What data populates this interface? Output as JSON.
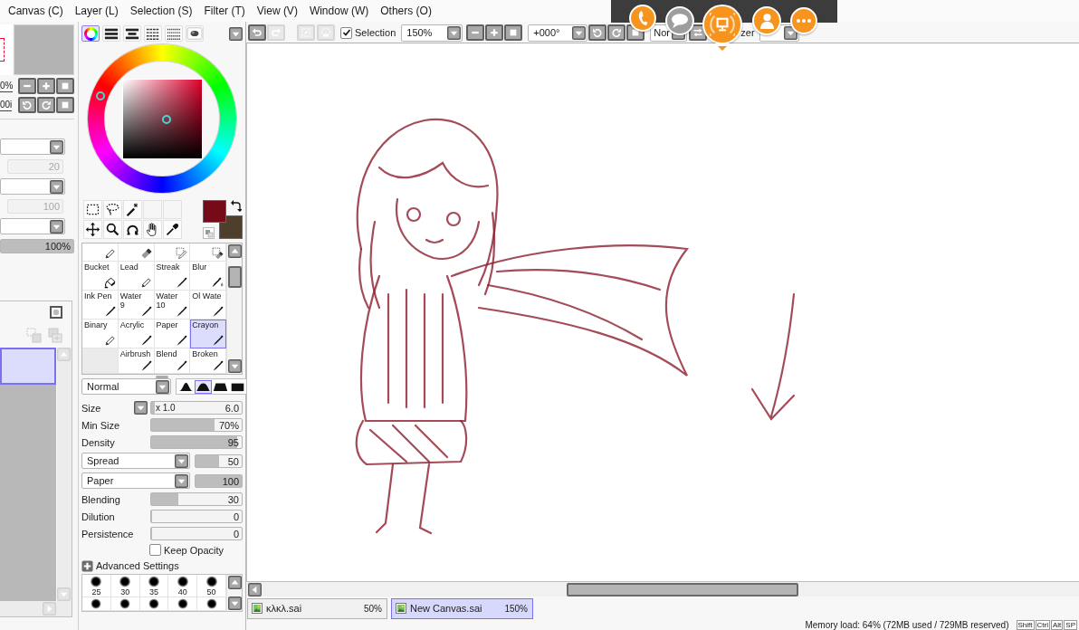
{
  "menu_bar": {
    "items": [
      "Canvas (C)",
      "Layer (L)",
      "Selection (S)",
      "Filter (T)",
      "View (V)",
      "Window (W)",
      "Others (O)"
    ]
  },
  "navigator": {
    "zoom_reading": "0%",
    "angle_reading": "00i",
    "zoom_buttons": [
      {
        "kind": "zoom-out"
      },
      {
        "kind": "zoom-in"
      },
      {
        "kind": "zoom-reset"
      }
    ],
    "rotate_buttons": [
      {
        "kind": "rotate-left"
      },
      {
        "kind": "rotate-right"
      },
      {
        "kind": "rotate-reset"
      }
    ]
  },
  "layer_properties": [
    {
      "kind": "dropdown",
      "disabled": false
    },
    {
      "kind": "slider",
      "reading": "20",
      "disabled": true
    },
    {
      "kind": "dropdown",
      "disabled": false
    },
    {
      "kind": "slider",
      "reading": "100",
      "disabled": true
    },
    {
      "kind": "dropdown",
      "disabled": false
    },
    {
      "kind": "slider",
      "reading": "100%",
      "level": 1,
      "disabled": false
    }
  ],
  "layer_panel": {
    "layers": [
      {
        "selected": true
      }
    ]
  },
  "color_panel": {
    "modes": [
      {
        "kind": "wheel",
        "selected": true
      },
      {
        "kind": "rgb",
        "selected": false
      },
      {
        "kind": "hsv",
        "selected": false
      },
      {
        "kind": "swatches",
        "selected": false
      },
      {
        "kind": "grid",
        "selected": false
      },
      {
        "kind": "scratchpad",
        "selected": false
      }
    ],
    "colors": [
      {
        "kind": "primary",
        "color": "#770a19"
      },
      {
        "kind": "secondary",
        "color": "#4e3f2d"
      }
    ]
  },
  "tools": [
    {
      "kind": "rect-select"
    },
    {
      "kind": "lasso"
    },
    {
      "kind": "magic-wand"
    },
    {
      "kind": "empty"
    },
    {
      "kind": "empty"
    },
    {
      "kind": "move"
    },
    {
      "kind": "zoom"
    },
    {
      "kind": "rotate"
    },
    {
      "kind": "hand"
    },
    {
      "kind": "eyedropper"
    }
  ],
  "brushes": [
    {
      "kind": "pencil",
      "selected": false
    },
    {
      "kind": "eraser",
      "selected": false
    },
    {
      "kind": "select-pen",
      "selected": false
    },
    {
      "kind": "select-eraser",
      "selected": false
    },
    {
      "label": "Bucket",
      "kind": "bucket",
      "selected": false
    },
    {
      "label": "Lead",
      "kind": "pencil",
      "selected": false
    },
    {
      "label": "Streak",
      "kind": "pen",
      "selected": false
    },
    {
      "label": "Blur",
      "kind": "blur",
      "selected": false
    },
    {
      "label": "Ink Pen",
      "kind": "pen",
      "selected": false
    },
    {
      "label": "Water\n9",
      "kind": "pen",
      "selected": false
    },
    {
      "label": "Water\n10",
      "kind": "pen",
      "selected": false
    },
    {
      "label": "Ol Wate",
      "kind": "pen",
      "selected": false
    },
    {
      "label": "Binary",
      "kind": "pencil",
      "selected": false
    },
    {
      "label": "Acrylic",
      "kind": "pen",
      "selected": false
    },
    {
      "label": "Paper",
      "kind": "pen",
      "selected": false
    },
    {
      "label": "Crayon",
      "kind": "pen",
      "selected": true
    },
    {
      "kind": "empty",
      "selected": false
    },
    {
      "label": "Airbrush",
      "kind": "pen",
      "selected": false
    },
    {
      "label": "Blend",
      "kind": "pen",
      "selected": false
    },
    {
      "label": "Broken",
      "kind": "pen",
      "selected": false
    }
  ],
  "brush_settings": {
    "blend_mode": "Normal",
    "shapes": [
      {
        "kind": "peak",
        "selected": false
      },
      {
        "kind": "mound",
        "selected": true
      },
      {
        "kind": "flat",
        "selected": false
      },
      {
        "kind": "block",
        "selected": false
      }
    ],
    "rows": [
      {
        "kind": "slider",
        "label": "Size",
        "menu": true,
        "scale": "x 1.0",
        "reading": "6.0",
        "level": 0.04
      },
      {
        "kind": "slider",
        "label": "Min Size",
        "menu": false,
        "reading": "70%",
        "level": 0.7
      },
      {
        "kind": "slider",
        "label": "Density",
        "menu": false,
        "reading": "95",
        "level": 0.95
      },
      {
        "kind": "select",
        "value": "Spread",
        "reading": "50",
        "level": 0.5
      },
      {
        "kind": "select",
        "value": "Paper",
        "reading": "100",
        "level": 1
      },
      {
        "kind": "slider",
        "label": "Blending",
        "menu": false,
        "reading": "30",
        "level": 0.3
      },
      {
        "kind": "slider",
        "label": "Dilution",
        "menu": false,
        "reading": "0",
        "level": 0
      },
      {
        "kind": "slider",
        "label": "Persistence",
        "menu": false,
        "reading": "0",
        "level": 0
      },
      {
        "kind": "checkbox",
        "label": "Keep Opacity",
        "checked": false
      },
      {
        "kind": "expander",
        "label": "Advanced Settings",
        "expanded": false
      }
    ]
  },
  "brush_sizes": [
    {
      "kind": "labeled",
      "label": "25"
    },
    {
      "kind": "labeled",
      "label": "30"
    },
    {
      "kind": "labeled",
      "label": "35"
    },
    {
      "kind": "labeled",
      "label": "40"
    },
    {
      "kind": "labeled",
      "label": "50"
    },
    {
      "kind": "unlabeled"
    },
    {
      "kind": "unlabeled"
    },
    {
      "kind": "unlabeled"
    },
    {
      "kind": "unlabeled"
    },
    {
      "kind": "unlabeled"
    }
  ],
  "toolbar": [
    {
      "kind": "undo",
      "disabled": false
    },
    {
      "kind": "redo",
      "disabled": true
    },
    {
      "kind": "deselect",
      "disabled": true
    },
    {
      "kind": "invert",
      "disabled": true
    },
    {
      "kind": "checkbox",
      "label": "Selection",
      "checked": true
    },
    {
      "kind": "zoom-select",
      "value": "150%"
    },
    {
      "kind": "zoom-out",
      "disabled": false
    },
    {
      "kind": "zoom-in",
      "disabled": false
    },
    {
      "kind": "zoom-reset",
      "disabled": false
    },
    {
      "kind": "angle-select",
      "value": "+000°"
    },
    {
      "kind": "rotate-left",
      "disabled": false
    },
    {
      "kind": "rotate-right",
      "disabled": false
    },
    {
      "kind": "rotate-reset",
      "disabled": false
    },
    {
      "kind": "mode-select",
      "value": "Nor"
    },
    {
      "kind": "flip",
      "disabled": false
    },
    {
      "kind": "label",
      "text": "zer"
    },
    {
      "kind": "stabilizer-select"
    }
  ],
  "call_bar": {
    "buttons": [
      {
        "kind": "phone",
        "selected": false,
        "disabled": false
      },
      {
        "kind": "chat",
        "selected": false,
        "disabled": true
      },
      {
        "kind": "screen",
        "selected": true,
        "disabled": false
      },
      {
        "kind": "person",
        "selected": false,
        "disabled": false
      },
      {
        "kind": "more",
        "selected": false,
        "disabled": false
      }
    ]
  },
  "document_tabs": [
    {
      "title": "κλκλ.sai",
      "zoom": "50%",
      "selected": false
    },
    {
      "title": "New Canvas.sai",
      "zoom": "150%",
      "selected": true
    }
  ],
  "status_bar": {
    "memory": "Memory load: 64% (72MB used / 729MB reserved)",
    "keys": [
      "Shift",
      "Ctrl",
      "Alt",
      "SP"
    ]
  }
}
